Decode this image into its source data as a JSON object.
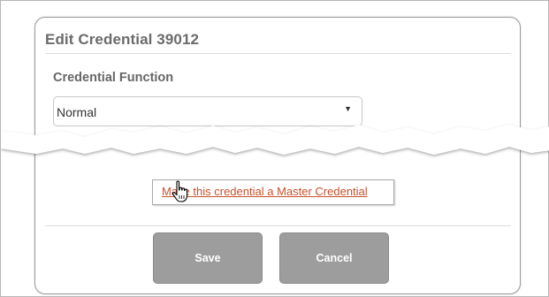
{
  "dialog": {
    "title": "Edit Credential 39012"
  },
  "credential_function": {
    "label": "Credential Function",
    "selected": "Normal",
    "arrow_icon": "triangle-down"
  },
  "master_link": {
    "text": "Make this credential a Master Credential"
  },
  "buttons": {
    "save": "Save",
    "cancel": "Cancel"
  },
  "colors": {
    "link": "#c9502a",
    "button_bg": "#9d9d9d",
    "title_text": "#6b6b6b"
  }
}
